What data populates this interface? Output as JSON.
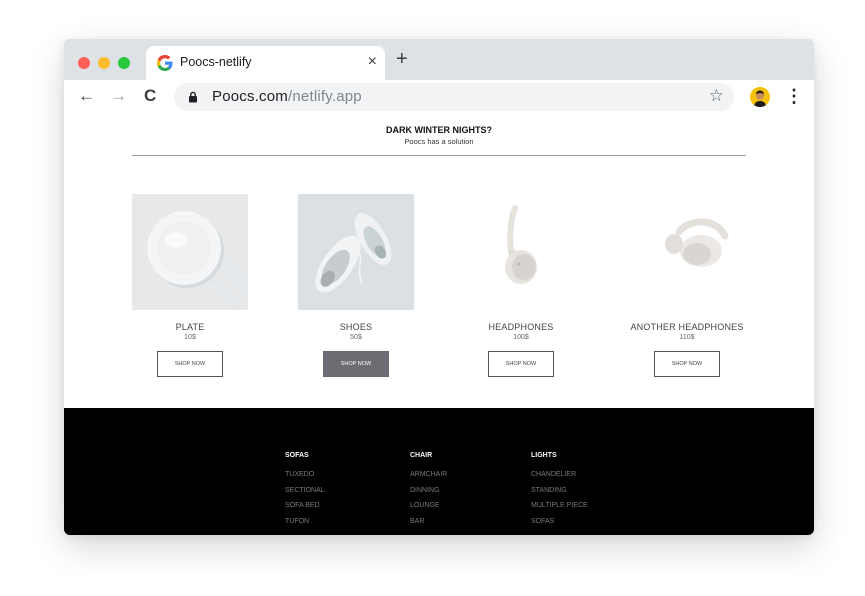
{
  "colors": {
    "accent": "#6b6d72",
    "footer_bg": "#000000",
    "tabbar_bg": "#dee1e6"
  },
  "browser": {
    "tab_title": "Poocs-netlify",
    "tab_close": "×",
    "new_tab": "+",
    "back": "←",
    "forward": "→",
    "reload": "C",
    "url_host": "Poocs.com",
    "url_path": "/netlify.app",
    "bookmark": "☆",
    "menu": "⋮"
  },
  "hero": {
    "title": "DARK WINTER NIGHTS?",
    "subtitle": "Poocs has a solution"
  },
  "products": [
    {
      "name": "PLATE",
      "price": "10$",
      "button": "SHOP NOW",
      "image": "plate"
    },
    {
      "name": "SHOES",
      "price": "50$",
      "button": "SHOP NOW",
      "image": "shoes",
      "button_style": "dark"
    },
    {
      "name": "HEADPHONES",
      "price": "100$",
      "button": "SHOP NOW",
      "image": "headphones"
    },
    {
      "name": "ANOTHER HEADPHONES",
      "price": "110$",
      "button": "SHOP NOW",
      "image": "headphones-2"
    }
  ],
  "footer": {
    "columns": [
      {
        "heading": "SOFAS",
        "items": [
          "TUXEDO",
          "SECTIONAL",
          "SOFA BED",
          "TUFON"
        ]
      },
      {
        "heading": "CHAIR",
        "items": [
          "ARMCHAIR",
          "DINNING",
          "LOUNGE",
          "BAR"
        ]
      },
      {
        "heading": "LIGHTS",
        "items": [
          "CHANDELIER",
          "STANDING",
          "MULTIPLE PIECE",
          "SOFAS"
        ]
      }
    ]
  }
}
